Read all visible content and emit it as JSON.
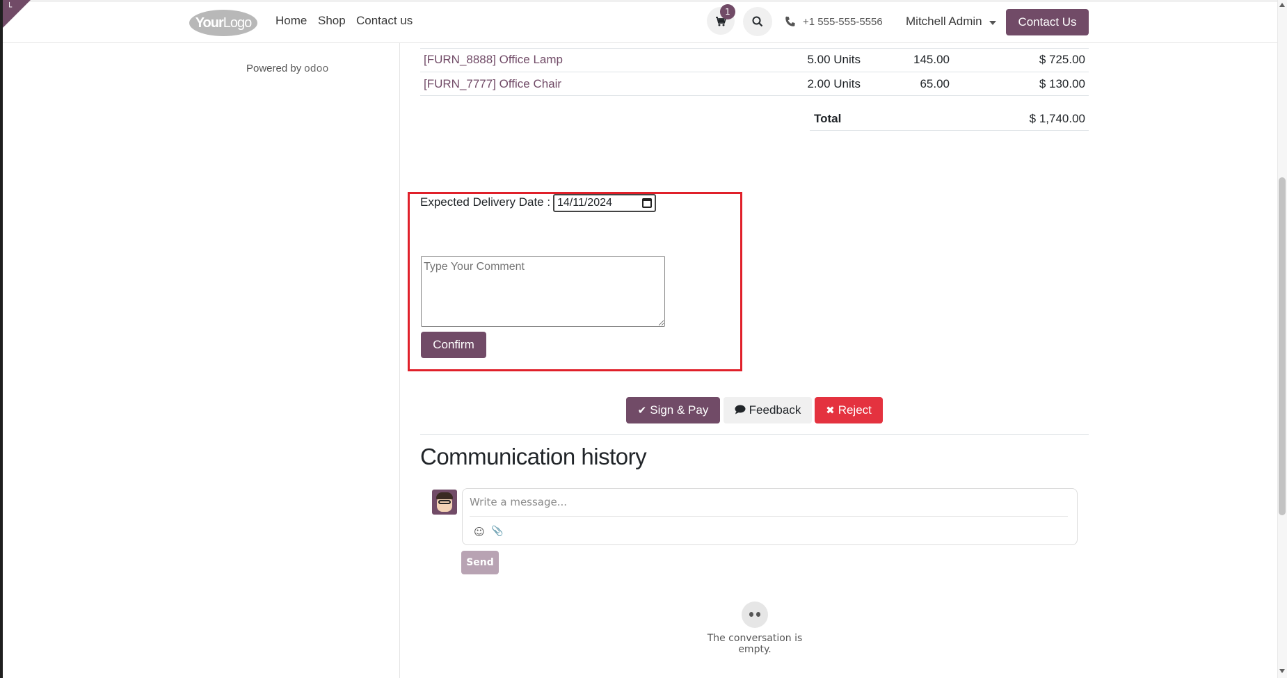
{
  "header": {
    "logo_bold": "Your",
    "logo_thin": "Logo",
    "nav": [
      "Home",
      "Shop",
      "Contact us"
    ],
    "cart_count": "1",
    "phone": "+1 555-555-5556",
    "user": "Mitchell Admin",
    "contact_button": "Contact Us"
  },
  "sidebar": {
    "powered_by": "Powered by",
    "brand": "odoo"
  },
  "order_lines": [
    {
      "product": "[FURN_8888] Office Lamp",
      "quantity": "5.00 Units",
      "unit_price": "145.00",
      "amount": "$ 725.00"
    },
    {
      "product": "[FURN_7777] Office Chair",
      "quantity": "2.00 Units",
      "unit_price": "65.00",
      "amount": "$ 130.00"
    }
  ],
  "total": {
    "label": "Total",
    "value": "$ 1,740.00"
  },
  "delivery_form": {
    "label": "Expected Delivery Date :",
    "date_value": "14/11/2024",
    "comment_placeholder": "Type Your Comment",
    "confirm_label": "Confirm"
  },
  "actions": {
    "sign_pay": "Sign & Pay",
    "feedback": "Feedback",
    "reject": "Reject"
  },
  "communication": {
    "title": "Communication history",
    "message_placeholder": "Write a message...",
    "send_label": "Send",
    "empty_text": "The conversation is empty."
  },
  "colors": {
    "brand": "#714B67",
    "danger": "#e4323f",
    "highlight": "#e0202a"
  },
  "icons": [
    "cart-icon",
    "search-icon",
    "phone-icon",
    "check-icon",
    "comment-icon",
    "close-icon",
    "emoji-icon",
    "paperclip-icon",
    "calendar-icon"
  ]
}
